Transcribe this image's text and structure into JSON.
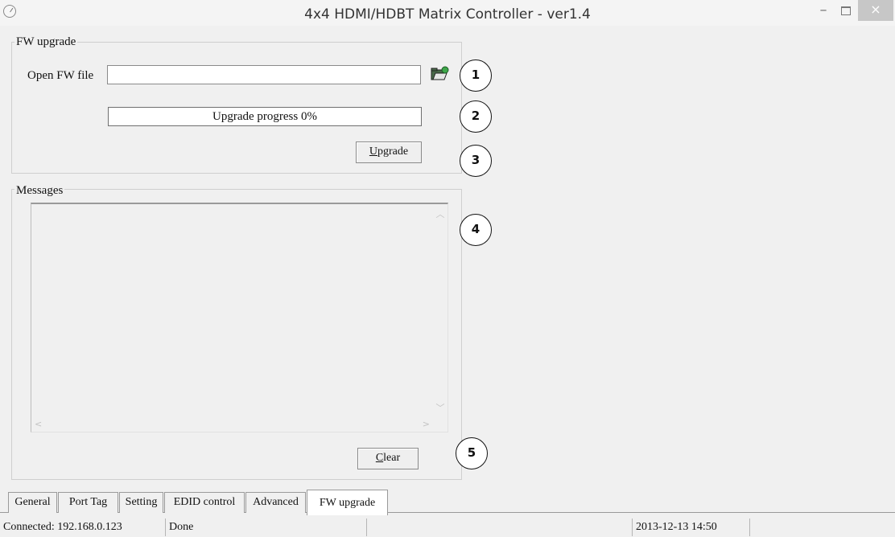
{
  "window": {
    "title": "4x4 HDMI/HDBT Matrix Controller - ver1.4",
    "minimize": "–",
    "close": "×"
  },
  "fw_group": {
    "label": "FW upgrade",
    "open_file_label": "Open FW file",
    "file_value": "",
    "progress_text": "Upgrade progress 0%",
    "progress_value": 0,
    "upgrade_button": {
      "accel": "U",
      "rest": "pgrade"
    }
  },
  "messages_group": {
    "label": "Messages",
    "content": "",
    "clear_button": {
      "accel": "C",
      "rest": "lear"
    }
  },
  "callouts": [
    "1",
    "2",
    "3",
    "4",
    "5"
  ],
  "tabs": [
    "General",
    "Port Tag",
    "Setting",
    "EDID control",
    "Advanced",
    "FW upgrade"
  ],
  "active_tab": "FW upgrade",
  "status": {
    "connection": "Connected: 192.168.0.123",
    "state": "Done",
    "middle": "",
    "datetime": "2013-12-13 14:50",
    "extra": ""
  },
  "icons": {
    "app": "app-gear-icon",
    "folder": "open-folder-icon"
  },
  "colors": {
    "window_bg": "#f0f0f0",
    "field_bg": "#ffffff",
    "close_button": "#c7c7c7",
    "folder_icon": "#4a6a4a",
    "folder_badge": "#3ea64a"
  }
}
